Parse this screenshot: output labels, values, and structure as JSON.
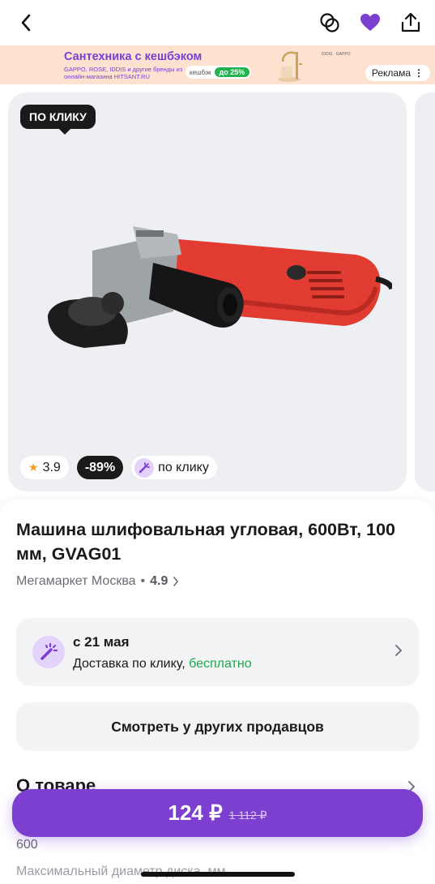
{
  "ad": {
    "title": "Сантехника с кешбэком",
    "subtitle": "GAPPO, ROSE, IDDIS и другие бренды из онлайн-магазина HITSANT.RU",
    "cashback_label": "кешбэк",
    "cashback_value": "до 25%",
    "brands_text": "IDDIS · GAPPO",
    "ad_label": "Реклама"
  },
  "gallery": {
    "badge": "ПО КЛИКУ",
    "rating": "3.9",
    "discount": "-89%",
    "delivery_chip": "по клику"
  },
  "product": {
    "title": "Машина шлифовальная угловая, 600Вт, 100 мм, GVAG01",
    "seller": "Мегамаркет Москва",
    "seller_rating": "4.9"
  },
  "delivery": {
    "date": "с 21 мая",
    "text": "Доставка по клику,",
    "free": "бесплатно"
  },
  "other_sellers": "Смотреть у других продавцов",
  "about": {
    "title": "О товаре",
    "spec_value": "600",
    "spec_label": "Максимальный диаметр диска, мм"
  },
  "buy": {
    "price": "124 ₽",
    "old_price": "1 112 ₽"
  },
  "colors": {
    "accent": "#7c3fd0",
    "free": "#1ba94c"
  }
}
